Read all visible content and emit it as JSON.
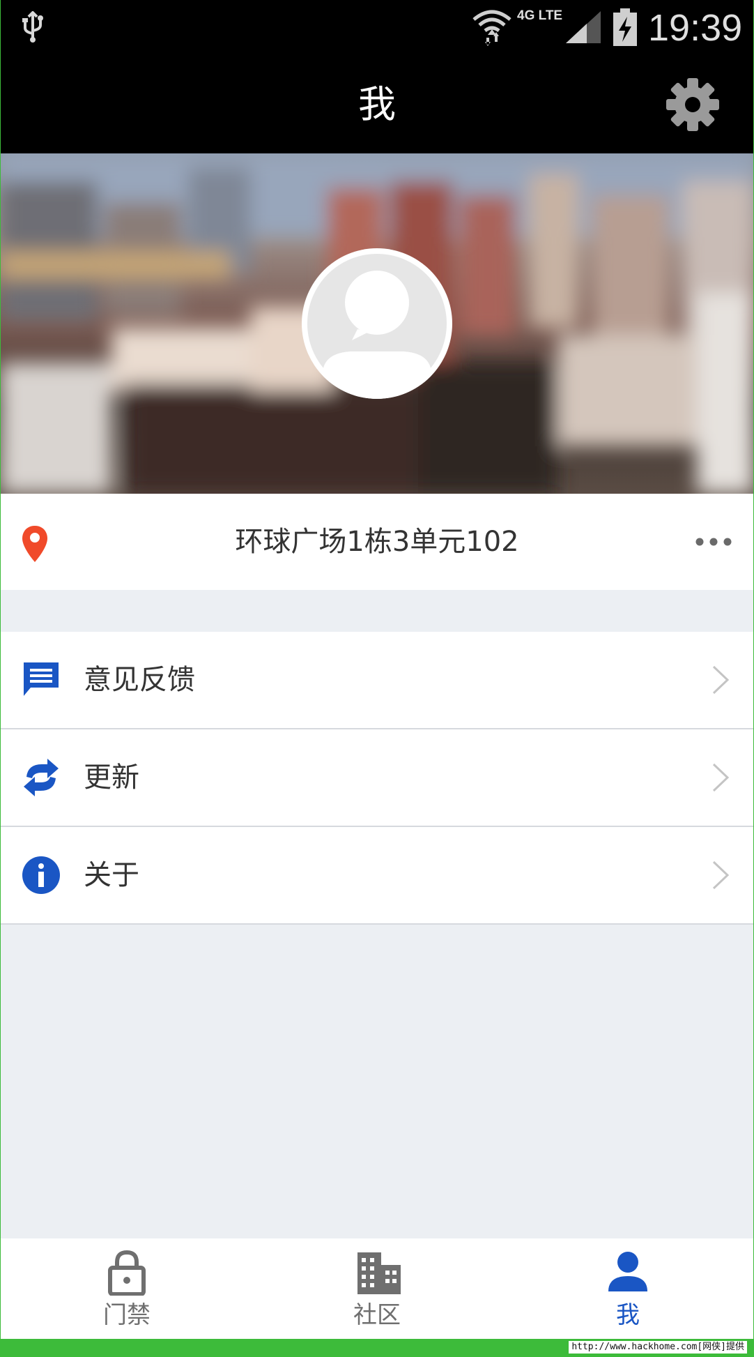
{
  "status_bar": {
    "network": "4G LTE",
    "time": "19:39",
    "icons": [
      "usb-icon",
      "wifi-icon",
      "signal-icon",
      "battery-charging-icon"
    ]
  },
  "header": {
    "title": "我",
    "settings_icon": "gear-icon"
  },
  "profile": {
    "avatar_icon": "default-avatar-icon",
    "address": "环球广场1栋3单元102",
    "address_icon": "location-pin-icon",
    "more_icon": "more-dots-icon"
  },
  "menu": [
    {
      "label": "意见反馈",
      "icon": "feedback-message-icon"
    },
    {
      "label": "更新",
      "icon": "refresh-icon"
    },
    {
      "label": "关于",
      "icon": "info-icon"
    }
  ],
  "bottom_nav": [
    {
      "label": "门禁",
      "icon": "lock-icon",
      "active": false
    },
    {
      "label": "社区",
      "icon": "building-icon",
      "active": false
    },
    {
      "label": "我",
      "icon": "person-icon",
      "active": true
    }
  ],
  "watermark": "http://www.hackhome.com[网侠]提供",
  "colors": {
    "accent": "#1a56c4",
    "pin": "#f04a2a",
    "background": "#eceff3",
    "inactive": "#6f6f6f",
    "watermark_bar": "#3dbb3a"
  }
}
